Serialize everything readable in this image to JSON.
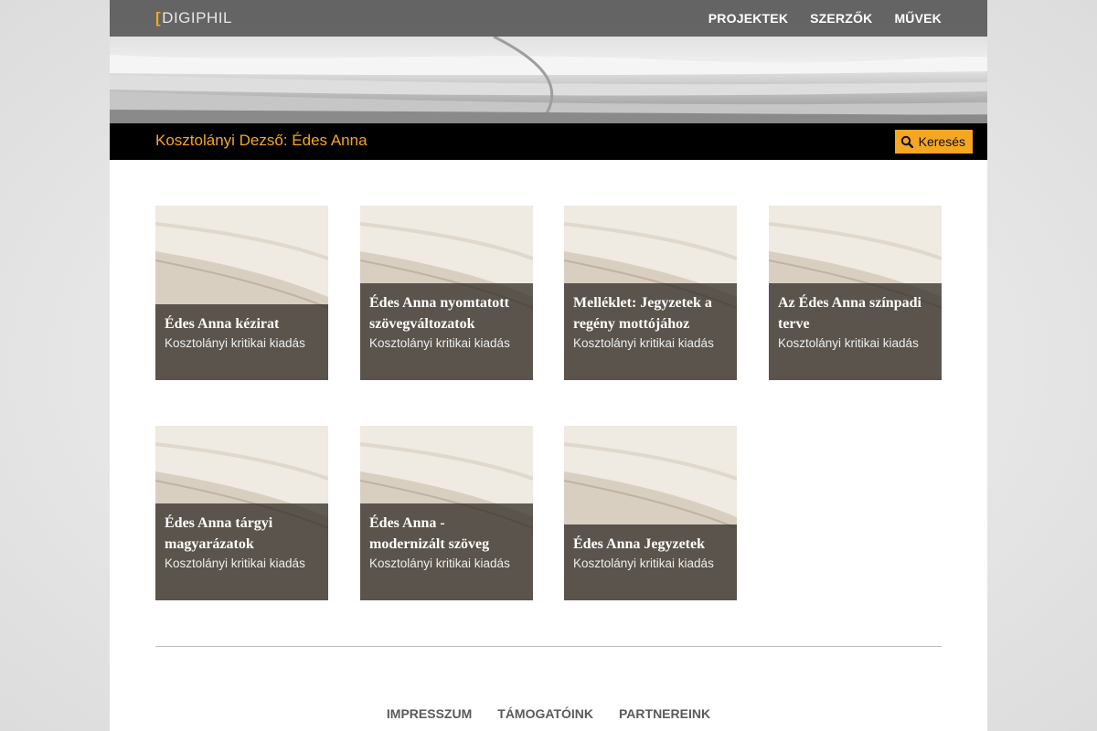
{
  "header": {
    "logo_bracket": "[",
    "logo_text": "DIGIPHIL",
    "nav": [
      {
        "label": "PROJEKTEK"
      },
      {
        "label": "SZERZŐK"
      },
      {
        "label": "MŰVEK"
      }
    ]
  },
  "titlebar": {
    "title": "Kosztolányi Dezső: Édes Anna",
    "search_label": "Keresés"
  },
  "cards": [
    {
      "title": "Édes Anna kézirat",
      "subtitle": "Kosztolányi kritikai kiadás"
    },
    {
      "title": "Édes Anna nyomtatott szövegváltozatok",
      "subtitle": "Kosztolányi kritikai kiadás"
    },
    {
      "title": "Melléklet: Jegyzetek a regény mottójához",
      "subtitle": "Kosztolányi kritikai kiadás"
    },
    {
      "title": "Az Édes Anna színpadi terve",
      "subtitle": "Kosztolányi kritikai kiadás"
    },
    {
      "title": "Édes Anna tárgyi magyarázatok",
      "subtitle": "Kosztolányi kritikai kiadás"
    },
    {
      "title": "Édes Anna - modernizált szöveg",
      "subtitle": "Kosztolányi kritikai kiadás"
    },
    {
      "title": "Édes Anna Jegyzetek",
      "subtitle": "Kosztolányi kritikai kiadás"
    }
  ],
  "footer": {
    "links": [
      {
        "label": "IMPRESSZUM"
      },
      {
        "label": "TÁMOGATÓINK"
      },
      {
        "label": "PARTNEREINK"
      }
    ]
  },
  "colors": {
    "accent": "#f5a623",
    "titlebar_bg": "#000000",
    "topbar_bg": "#5a5a5a"
  }
}
